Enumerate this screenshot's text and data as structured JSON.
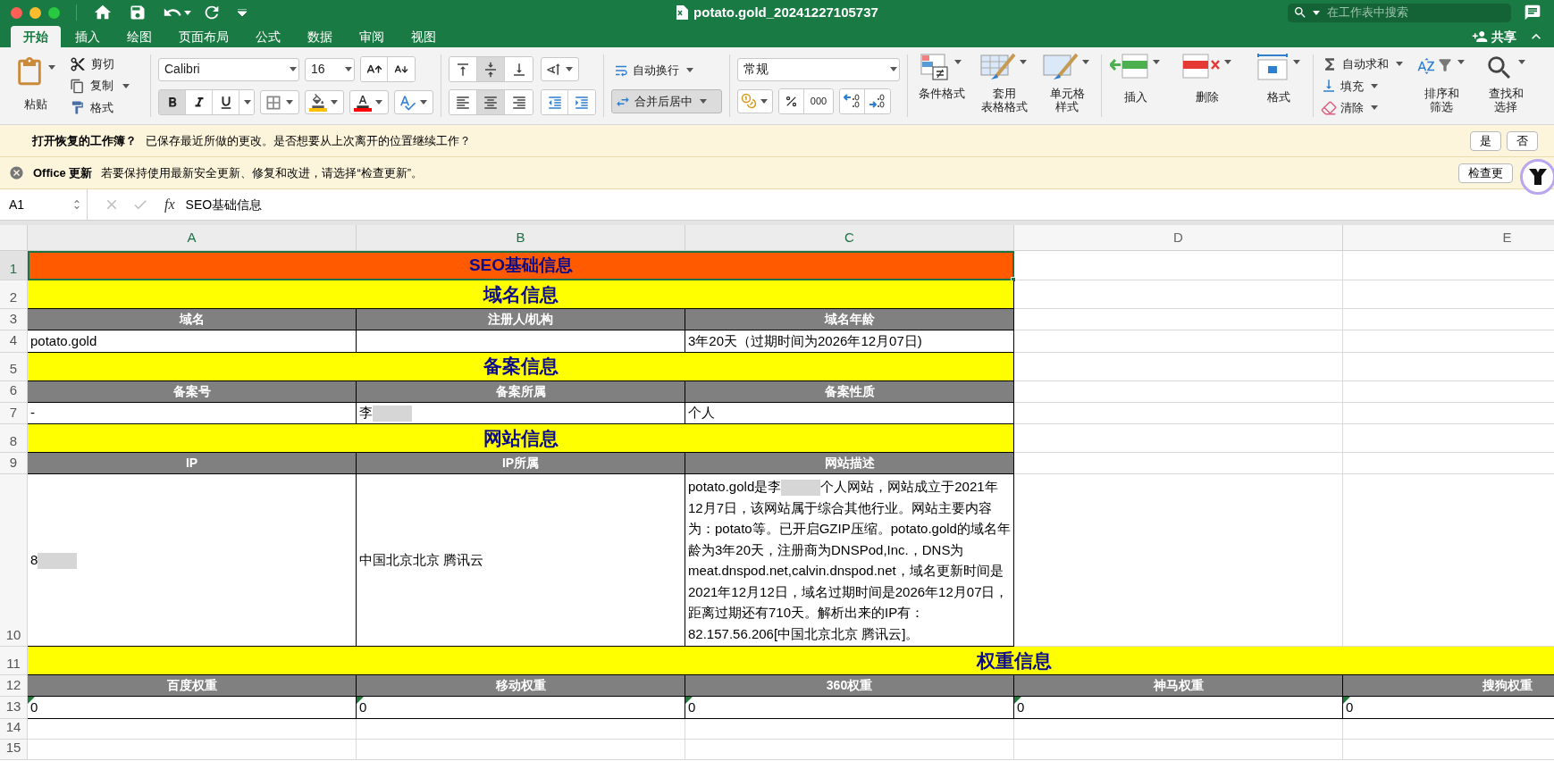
{
  "window": {
    "title": "potato.gold_20241227105737"
  },
  "search": {
    "placeholder": "在工作表中搜索"
  },
  "share": {
    "label": "共享"
  },
  "tabs": [
    {
      "label": "开始",
      "selected": true
    },
    {
      "label": "插入",
      "selected": false
    },
    {
      "label": "绘图",
      "selected": false
    },
    {
      "label": "页面布局",
      "selected": false
    },
    {
      "label": "公式",
      "selected": false
    },
    {
      "label": "数据",
      "selected": false
    },
    {
      "label": "审阅",
      "selected": false
    },
    {
      "label": "视图",
      "selected": false
    }
  ],
  "ribbon": {
    "clipboard": {
      "paste": "粘贴",
      "cut": "剪切",
      "copy": "复制",
      "format_painter": "格式"
    },
    "font": {
      "name": "Calibri",
      "size": "16",
      "bold": true,
      "italic": false,
      "underline": false
    },
    "alignment": {
      "vertical": [
        {
          "kind": "top",
          "selected": false
        },
        {
          "kind": "middle",
          "selected": true
        },
        {
          "kind": "bottom",
          "selected": false
        }
      ],
      "horizontal": [
        {
          "kind": "left",
          "selected": false
        },
        {
          "kind": "center",
          "selected": true
        },
        {
          "kind": "right",
          "selected": false
        }
      ],
      "wrap_text": "自动换行",
      "merge": {
        "label": "合并后居中",
        "on": true
      }
    },
    "number": {
      "format": "常规",
      "comma_style": "000"
    },
    "styles": [
      {
        "kind": "conditional",
        "lines": [
          "条件格式"
        ]
      },
      {
        "kind": "table",
        "lines": [
          "套用",
          "表格格式"
        ]
      },
      {
        "kind": "cell",
        "lines": [
          "单元格",
          "样式"
        ]
      }
    ],
    "cells": [
      {
        "kind": "insert",
        "label": "插入"
      },
      {
        "kind": "delete",
        "label": "删除"
      },
      {
        "kind": "format",
        "label": "格式"
      }
    ],
    "editing": {
      "autosum": "自动求和",
      "fill": "填充",
      "clear": "清除",
      "sort_filter": [
        "排序和",
        "筛选"
      ],
      "find_select": [
        "查找和",
        "选择"
      ]
    }
  },
  "notifications": [
    {
      "kind": "recovery",
      "title": "打开恢复的工作簿？",
      "message": "已保存最近所做的更改。是否想要从上次离开的位置继续工作？",
      "buttons": [
        "是",
        "否"
      ]
    },
    {
      "kind": "update",
      "title": "Office 更新",
      "message": "若要保持使用最新安全更新、修复和改进，请选择“检查更新”。",
      "buttons": [
        "检查更"
      ]
    }
  ],
  "formula_bar": {
    "name_box": "A1",
    "function_label": "fx",
    "content": "SEO基础信息"
  },
  "sheet": {
    "columns": [
      {
        "label": "A",
        "selected": true
      },
      {
        "label": "B",
        "selected": true
      },
      {
        "label": "C",
        "selected": true
      },
      {
        "label": "D",
        "selected": false
      },
      {
        "label": "E",
        "selected": false
      }
    ],
    "rows": [
      {
        "number": "1",
        "kind": "title",
        "text": "SEO基础信息",
        "selected": true
      },
      {
        "number": "2",
        "kind": "section",
        "text": "域名信息"
      },
      {
        "number": "3",
        "kind": "header",
        "cells": [
          {
            "text": "域名"
          },
          {
            "text": "注册人/机构"
          },
          {
            "text": "域名年龄"
          }
        ]
      },
      {
        "number": "4",
        "kind": "data",
        "cells": [
          {
            "text": "potato.gold"
          },
          null,
          {
            "text": "3年20天（过期时间为2026年12月07日)"
          }
        ]
      },
      {
        "number": "5",
        "kind": "section",
        "text": "备案信息"
      },
      {
        "number": "6",
        "kind": "header",
        "cells": [
          {
            "text": "备案号"
          },
          {
            "text": "备案所属"
          },
          {
            "text": "备案性质"
          }
        ]
      },
      {
        "number": "7",
        "kind": "data",
        "cells": [
          {
            "text": "-"
          },
          {
            "parts": [
              {
                "kind": "text",
                "text": "李"
              },
              {
                "kind": "redaction"
              }
            ]
          },
          {
            "text": "个人"
          }
        ]
      },
      {
        "number": "8",
        "kind": "section",
        "text": "网站信息"
      },
      {
        "number": "9",
        "kind": "header",
        "cells": [
          {
            "text": "IP"
          },
          {
            "text": "IP所属"
          },
          {
            "text": "网站描述"
          }
        ]
      },
      {
        "number": "10",
        "kind": "data",
        "cells": [
          {
            "parts": [
              {
                "kind": "text",
                "text": "8"
              },
              {
                "kind": "redaction"
              }
            ]
          },
          {
            "text": "中国北京北京 腾讯云"
          },
          {
            "parts": [
              {
                "kind": "text",
                "text": "potato.gold是李"
              },
              {
                "kind": "redaction"
              },
              {
                "kind": "text",
                "text": "个人网站，网站成立于2021年12月7日，该网站属于综合其他行业。网站主要内容为：potato等。已开启GZIP压缩。potato.gold的域名年龄为3年20天，注册商为DNSPod,Inc.，DNS为meat.dnspod.net,calvin.dnspod.net，域名更新时间是2021年12月12日，域名过期时间是2026年12月07日，距离过期还有710天。解析出来的IP有：82.157.56.206[中国北京北京 腾讯云]。"
              }
            ]
          }
        ]
      },
      {
        "number": "11",
        "kind": "wide_section",
        "banner_text": "权重信息"
      },
      {
        "number": "12",
        "kind": "header",
        "cells": [
          {
            "text": "百度权重"
          },
          {
            "text": "移动权重"
          },
          {
            "text": "360权重"
          },
          {
            "text": "神马权重"
          },
          {
            "text": "搜狗权重"
          }
        ]
      },
      {
        "number": "13",
        "kind": "data",
        "cells": [
          {
            "text": "0",
            "flag": true
          },
          {
            "text": "0",
            "flag": true
          },
          {
            "text": "0",
            "flag": true
          },
          {
            "text": "0",
            "flag": true
          },
          {
            "text": "0",
            "flag": true
          }
        ]
      },
      {
        "number": "14",
        "kind": "empty"
      },
      {
        "number": "15",
        "kind": "empty"
      }
    ]
  }
}
